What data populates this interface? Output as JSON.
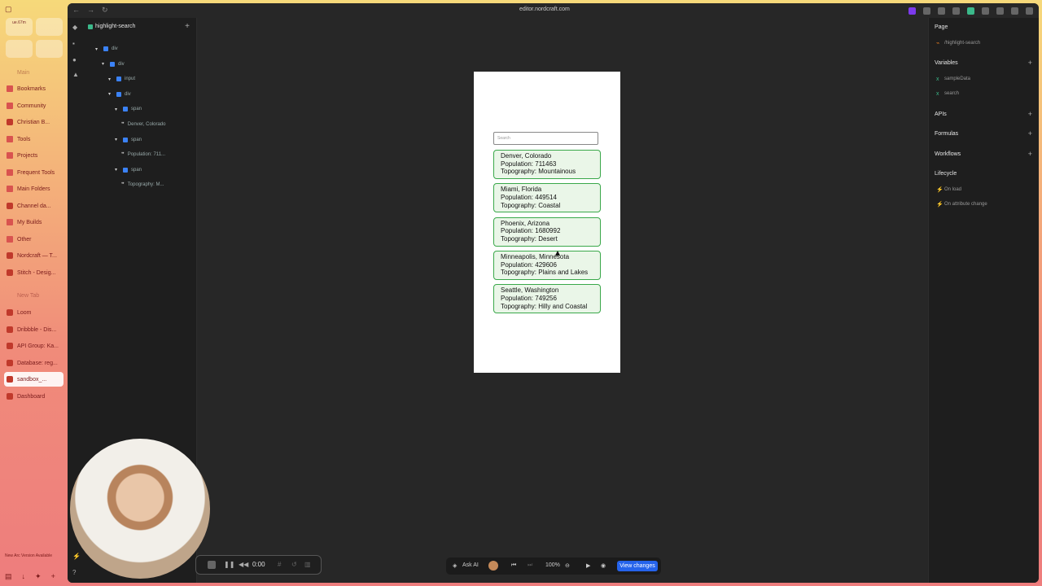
{
  "arc_sidebar": {
    "pinned": [
      "ue.67m",
      "",
      "",
      ""
    ],
    "items": [
      {
        "label": "Main",
        "type": "space"
      },
      {
        "label": "Bookmarks",
        "type": "folder"
      },
      {
        "label": "Community",
        "type": "folder"
      },
      {
        "label": "Christian B...",
        "type": "tab"
      },
      {
        "label": "Tools",
        "type": "folder"
      },
      {
        "label": "Projects",
        "type": "folder"
      },
      {
        "label": "Frequent Tools",
        "type": "folder"
      },
      {
        "label": "Main Folders",
        "type": "folder"
      },
      {
        "label": "Channel da...",
        "type": "tab"
      },
      {
        "label": "My Builds",
        "type": "folder"
      },
      {
        "label": "Other",
        "type": "folder"
      },
      {
        "label": "Nordcraft — T...",
        "type": "tab"
      },
      {
        "label": "Stitch - Desig...",
        "type": "tab"
      },
      {
        "label": "New Tab",
        "type": "new"
      },
      {
        "label": "Loom",
        "type": "tab"
      },
      {
        "label": "Dribbble - Dis...",
        "type": "tab"
      },
      {
        "label": "API Group: Ka...",
        "type": "tab"
      },
      {
        "label": "Database: reg...",
        "type": "tab"
      },
      {
        "label": "sandbox_...",
        "type": "active"
      },
      {
        "label": "Dashboard",
        "type": "tab"
      }
    ],
    "update_notice": "New Arc Version Available"
  },
  "browser": {
    "url": "editor.nordcraft.com"
  },
  "layers": {
    "component_name": "highlight-search",
    "tree": [
      {
        "label": "div",
        "depth": 0,
        "kind": "element"
      },
      {
        "label": "div",
        "depth": 1,
        "kind": "element"
      },
      {
        "label": "input",
        "depth": 2,
        "kind": "element"
      },
      {
        "label": "div",
        "depth": 2,
        "kind": "element"
      },
      {
        "label": "span",
        "depth": 3,
        "kind": "element"
      },
      {
        "label": "Denver, Colorado",
        "depth": 4,
        "kind": "text"
      },
      {
        "label": "span",
        "depth": 3,
        "kind": "element"
      },
      {
        "label": "Population: 711...",
        "depth": 4,
        "kind": "text"
      },
      {
        "label": "span",
        "depth": 3,
        "kind": "element"
      },
      {
        "label": "Topography: M...",
        "depth": 4,
        "kind": "text"
      }
    ]
  },
  "preview": {
    "search_placeholder": "Search",
    "cards": [
      {
        "city": "Denver, Colorado",
        "population": "Population: 711463",
        "topography": "Topography: Mountainous"
      },
      {
        "city": "Miami, Florida",
        "population": "Population: 449514",
        "topography": "Topography: Coastal"
      },
      {
        "city": "Phoenix, Arizona",
        "population": "Population: 1680992",
        "topography": "Topography: Desert"
      },
      {
        "city": "Minneapolis, Minnesota",
        "population": "Population: 429606",
        "topography": "Topography: Plains and Lakes"
      },
      {
        "city": "Seattle, Washington",
        "population": "Population: 749256",
        "topography": "Topography: Hilly and Coastal"
      }
    ]
  },
  "toolbar": {
    "ask_ai": "Ask AI",
    "zoom": "100%",
    "view_changes": "View changes"
  },
  "right_panel": {
    "page_title": "Page",
    "page_route": "/highlight-search",
    "variables_title": "Variables",
    "variables": [
      "sampleData",
      "search"
    ],
    "apis_title": "APIs",
    "formulas_title": "Formulas",
    "workflows_title": "Workflows",
    "lifecycle_title": "Lifecycle",
    "lifecycle": [
      "On load",
      "On attribute change"
    ]
  },
  "recorder": {
    "time": "0:00"
  }
}
